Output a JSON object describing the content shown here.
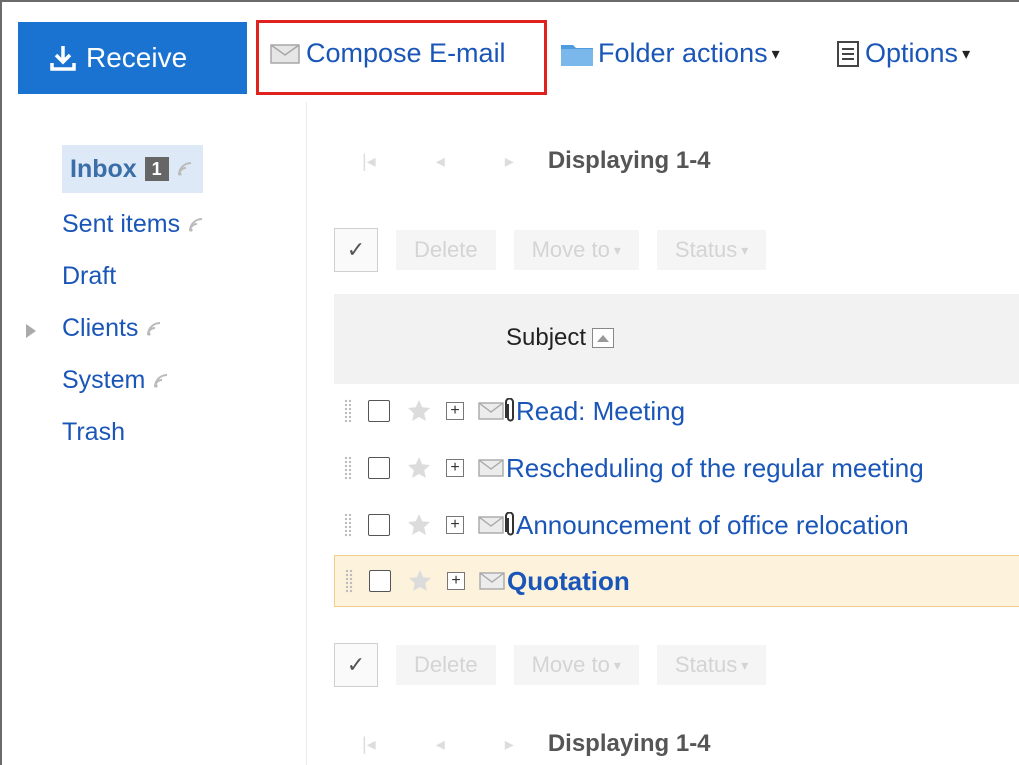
{
  "toolbar": {
    "receive_label": "Receive",
    "compose_label": "Compose E-mail",
    "folder_actions_label": "Folder actions",
    "options_label": "Options",
    "dropdown_glyph": "▾"
  },
  "sidebar": {
    "folders": [
      {
        "label": "Inbox",
        "badge": "1",
        "selected": true,
        "rss": true
      },
      {
        "label": "Sent items",
        "rss": true
      },
      {
        "label": "Draft",
        "rss": false
      },
      {
        "label": "Clients",
        "rss": true,
        "expandable": true
      },
      {
        "label": "System",
        "rss": true
      },
      {
        "label": "Trash",
        "rss": false
      }
    ]
  },
  "pager": {
    "first_glyph": "|◂",
    "prev_glyph": "◂",
    "next_glyph": "▸",
    "displaying": "Displaying 1-4"
  },
  "actions": {
    "select_all_glyph": "✓",
    "delete_label": "Delete",
    "move_to_label": "Move to",
    "status_label": "Status",
    "dropdown_glyph": "▾"
  },
  "list": {
    "subject_header": "Subject",
    "sort_glyph": "▲",
    "rows": [
      {
        "subject": "Read: Meeting",
        "attachment": true,
        "unread": false
      },
      {
        "subject": "Rescheduling of the regular meeting",
        "attachment": false,
        "unread": false
      },
      {
        "subject": "Announcement of office relocation",
        "attachment": true,
        "unread": false
      },
      {
        "subject": "Quotation",
        "attachment": false,
        "unread": true,
        "highlighted": true
      }
    ]
  },
  "colors": {
    "primary": "#1b73d1",
    "highlight_border": "#e0221f",
    "link": "#1a56b8",
    "selected_row": "#fdf2db"
  }
}
